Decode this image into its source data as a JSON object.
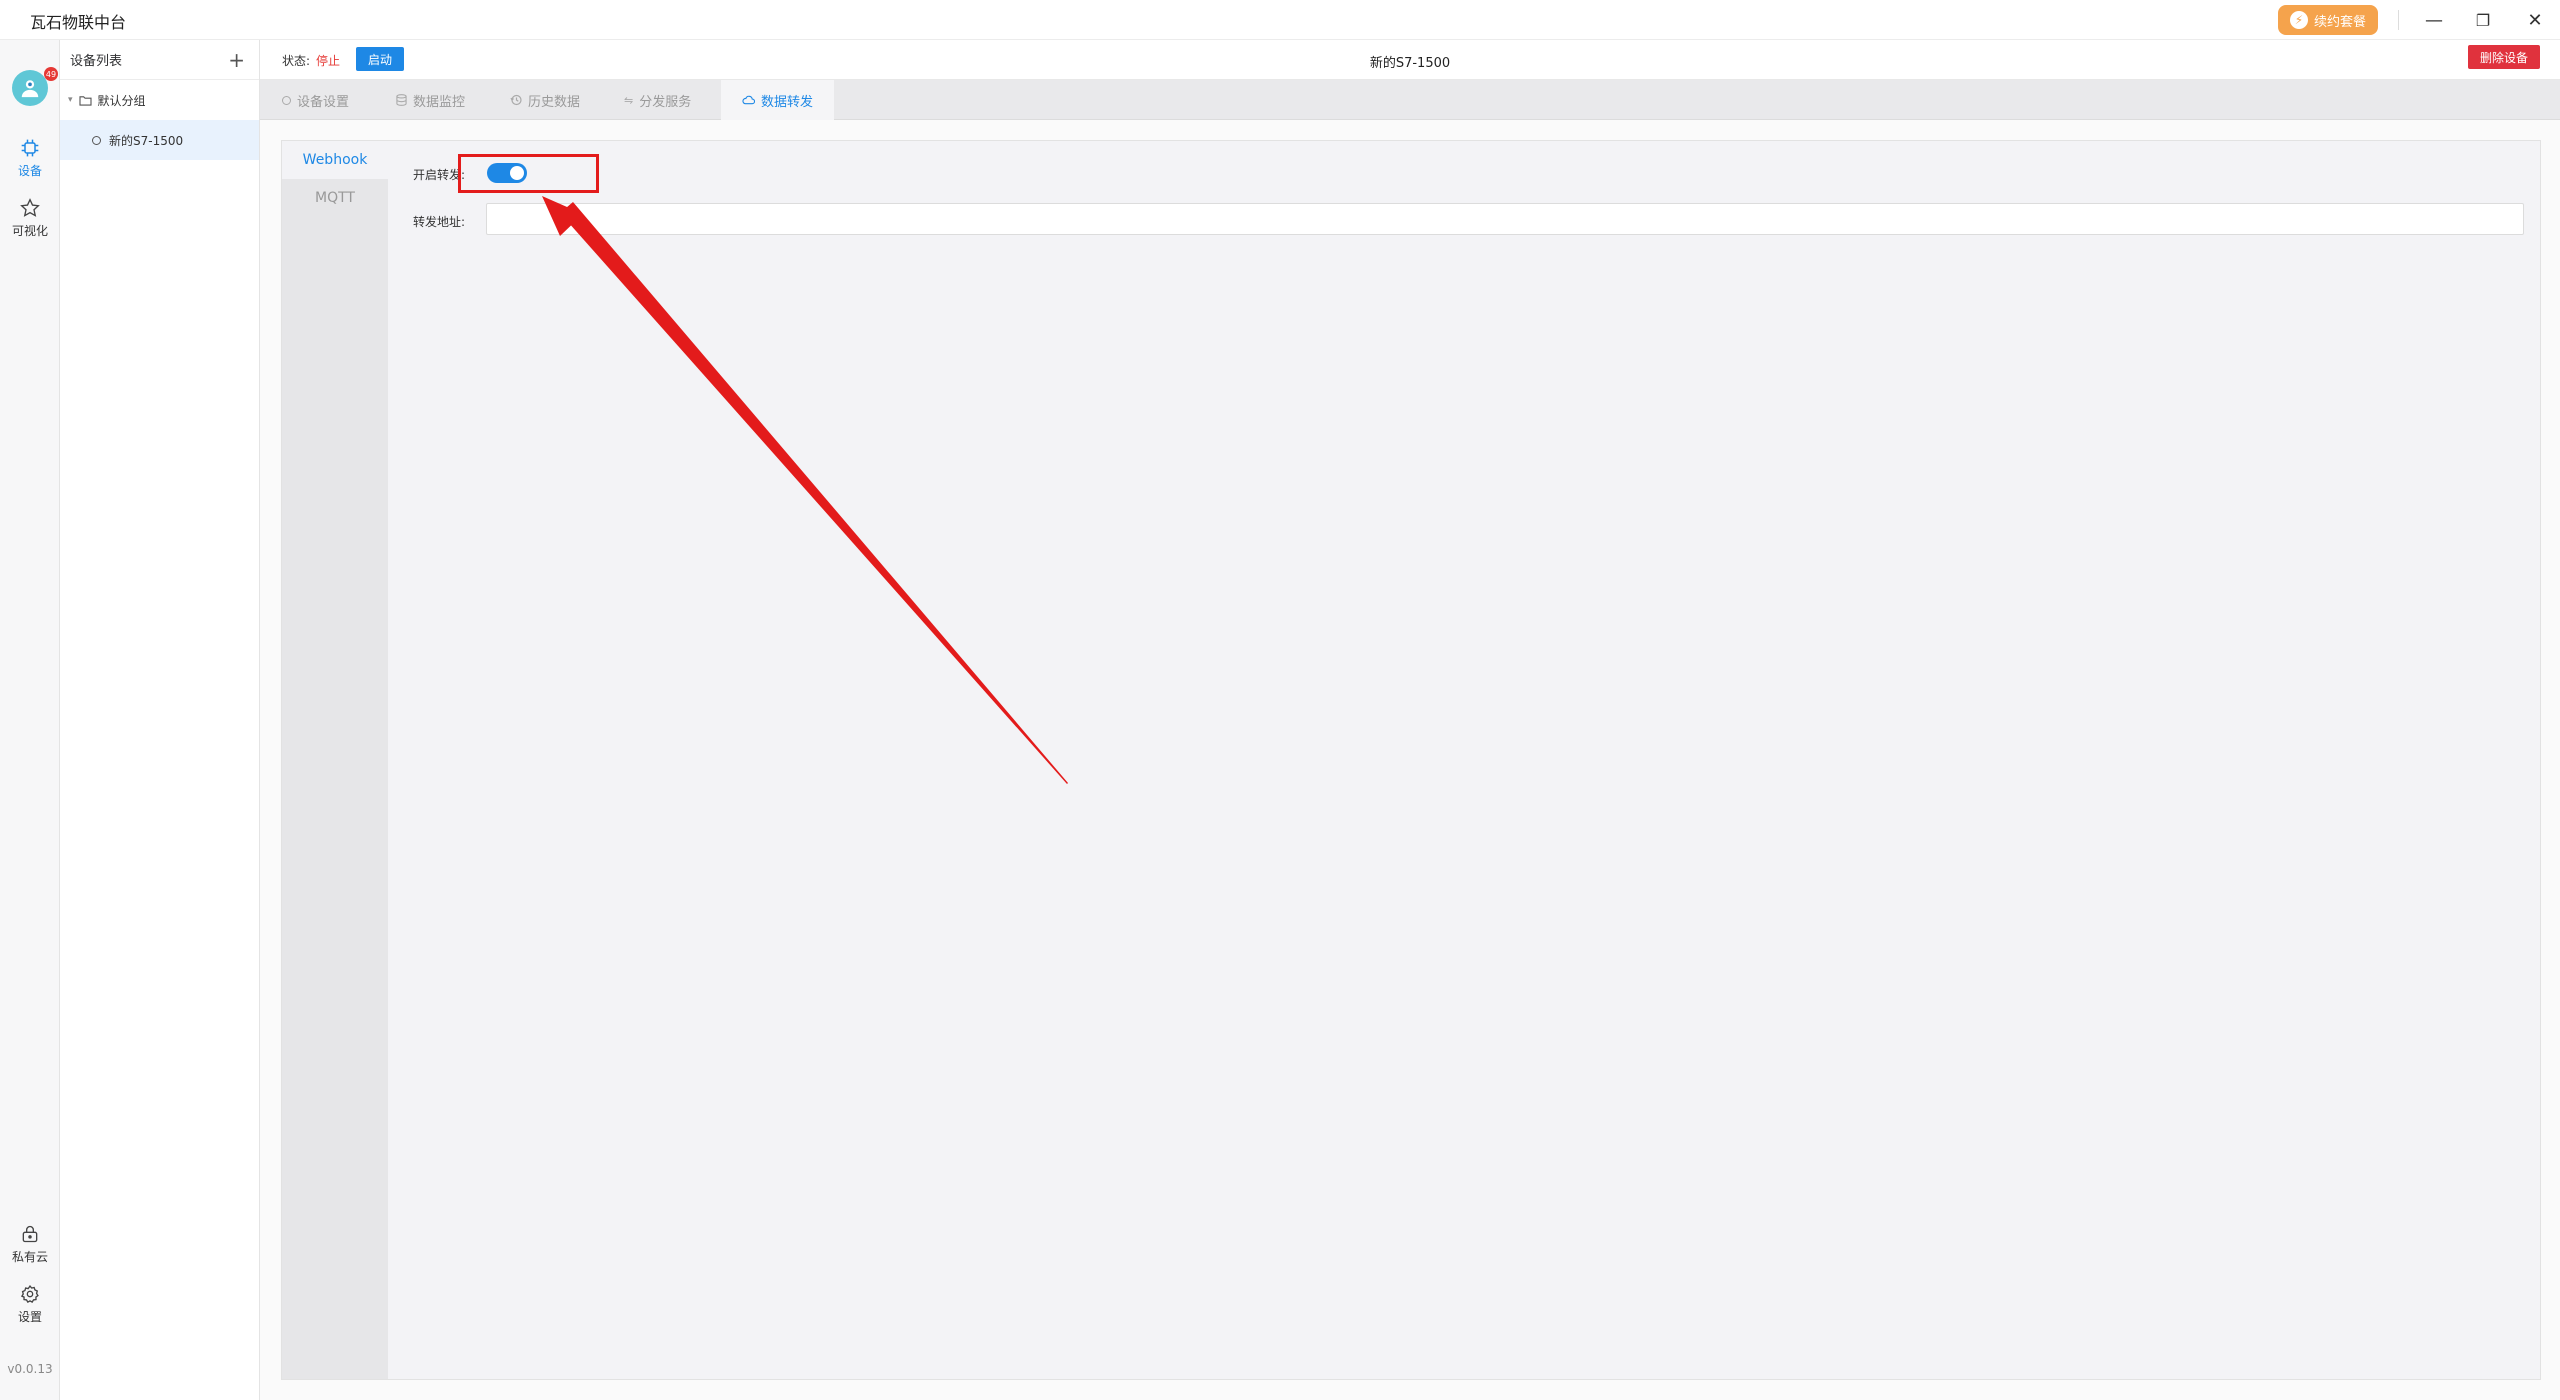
{
  "window": {
    "title": "瓦石物联中台",
    "plan_button": "续约套餐",
    "minimize": "—",
    "restore": "❐",
    "close": "✕"
  },
  "sidebar": {
    "avatar_badge": "49",
    "items": [
      {
        "label": "设备"
      },
      {
        "label": "可视化"
      },
      {
        "label": "私有云"
      },
      {
        "label": "设置"
      }
    ],
    "version": "v0.0.13"
  },
  "device_panel": {
    "title": "设备列表",
    "add": "+",
    "group": "默认分组",
    "device": "新的S7-1500"
  },
  "statusbar": {
    "status_label": "状态:",
    "status_value": "停止",
    "start_button": "启动",
    "device_title": "新的S7-1500",
    "delete_button": "删除设备"
  },
  "tabs": [
    {
      "label": "设备设置"
    },
    {
      "label": "数据监控"
    },
    {
      "label": "历史数据"
    },
    {
      "label": "分发服务"
    },
    {
      "label": "数据转发"
    }
  ],
  "forwarding": {
    "side_tabs": [
      {
        "label": "Webhook"
      },
      {
        "label": "MQTT"
      }
    ],
    "enable_label": "开启转发:",
    "enable_on": true,
    "url_label": "转发地址:",
    "url_value": "",
    "url_placeholder": ""
  },
  "colors": {
    "accent": "#1e88e5",
    "danger": "#e0323d",
    "annotation": "#e31b1b",
    "plan": "#f5a34c"
  }
}
